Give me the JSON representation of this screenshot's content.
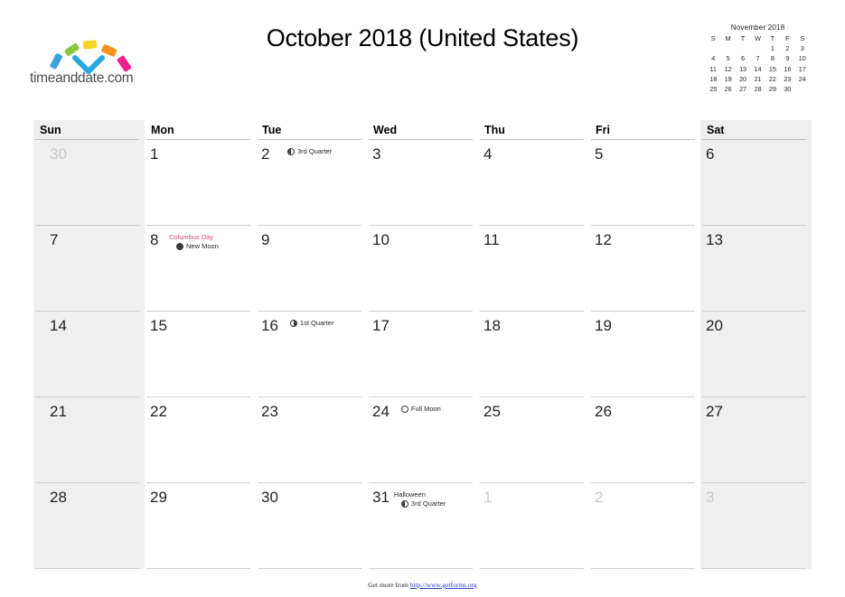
{
  "brand": {
    "logo_text": "timeanddate.com",
    "logo_colors": [
      "#3aa3dc",
      "#8cc63f",
      "#f9d423",
      "#f7941e",
      "#ec1f8e"
    ],
    "logo_check_color": "#29a9e0"
  },
  "header": {
    "title": "October 2018 (United States)"
  },
  "mini_month": {
    "title": "November 2018",
    "dow": [
      "S",
      "M",
      "T",
      "W",
      "T",
      "F",
      "S"
    ],
    "leading_blanks": 4,
    "days": [
      1,
      2,
      3,
      4,
      5,
      6,
      7,
      8,
      9,
      10,
      11,
      12,
      13,
      14,
      15,
      16,
      17,
      18,
      19,
      20,
      21,
      22,
      23,
      24,
      25,
      26,
      27,
      28,
      29,
      30
    ]
  },
  "calendar": {
    "weekday_headers": [
      "Sun",
      "Mon",
      "Tue",
      "Wed",
      "Thu",
      "Fri",
      "Sat"
    ],
    "weekend_columns": [
      0,
      6
    ],
    "accent_holiday_color": "#e0457b",
    "weeks": [
      [
        {
          "day": "30",
          "other_month": true,
          "events": []
        },
        {
          "day": "1",
          "other_month": false,
          "events": []
        },
        {
          "day": "2",
          "other_month": false,
          "events": [
            {
              "text": "3rd Quarter",
              "type": "moon",
              "icon": "third-quarter"
            }
          ]
        },
        {
          "day": "3",
          "other_month": false,
          "events": []
        },
        {
          "day": "4",
          "other_month": false,
          "events": []
        },
        {
          "day": "5",
          "other_month": false,
          "events": []
        },
        {
          "day": "6",
          "other_month": false,
          "events": []
        }
      ],
      [
        {
          "day": "7",
          "other_month": false,
          "events": []
        },
        {
          "day": "8",
          "other_month": false,
          "events": [
            {
              "text": "Columbus Day",
              "type": "holiday",
              "icon": null
            },
            {
              "text": "New Moon",
              "type": "moon",
              "icon": "new-moon"
            }
          ]
        },
        {
          "day": "9",
          "other_month": false,
          "events": []
        },
        {
          "day": "10",
          "other_month": false,
          "events": []
        },
        {
          "day": "11",
          "other_month": false,
          "events": []
        },
        {
          "day": "12",
          "other_month": false,
          "events": []
        },
        {
          "day": "13",
          "other_month": false,
          "events": []
        }
      ],
      [
        {
          "day": "14",
          "other_month": false,
          "events": []
        },
        {
          "day": "15",
          "other_month": false,
          "events": []
        },
        {
          "day": "16",
          "other_month": false,
          "events": [
            {
              "text": "1st Quarter",
              "type": "moon",
              "icon": "first-quarter"
            }
          ]
        },
        {
          "day": "17",
          "other_month": false,
          "events": []
        },
        {
          "day": "18",
          "other_month": false,
          "events": []
        },
        {
          "day": "19",
          "other_month": false,
          "events": []
        },
        {
          "day": "20",
          "other_month": false,
          "events": []
        }
      ],
      [
        {
          "day": "21",
          "other_month": false,
          "events": []
        },
        {
          "day": "22",
          "other_month": false,
          "events": []
        },
        {
          "day": "23",
          "other_month": false,
          "events": []
        },
        {
          "day": "24",
          "other_month": false,
          "events": [
            {
              "text": "Full Moon",
              "type": "moon",
              "icon": "full-moon"
            }
          ]
        },
        {
          "day": "25",
          "other_month": false,
          "events": []
        },
        {
          "day": "26",
          "other_month": false,
          "events": []
        },
        {
          "day": "27",
          "other_month": false,
          "events": []
        }
      ],
      [
        {
          "day": "28",
          "other_month": false,
          "events": []
        },
        {
          "day": "29",
          "other_month": false,
          "events": []
        },
        {
          "day": "30",
          "other_month": false,
          "events": []
        },
        {
          "day": "31",
          "other_month": false,
          "events": [
            {
              "text": "Halloween",
              "type": "observance",
              "icon": null
            },
            {
              "text": "3rd Quarter",
              "type": "moon",
              "icon": "third-quarter"
            }
          ]
        },
        {
          "day": "1",
          "other_month": true,
          "events": []
        },
        {
          "day": "2",
          "other_month": true,
          "events": []
        },
        {
          "day": "3",
          "other_month": true,
          "events": []
        }
      ]
    ]
  },
  "footer": {
    "prefix": "Get more from ",
    "link_text": "http://www.getforms.org"
  }
}
